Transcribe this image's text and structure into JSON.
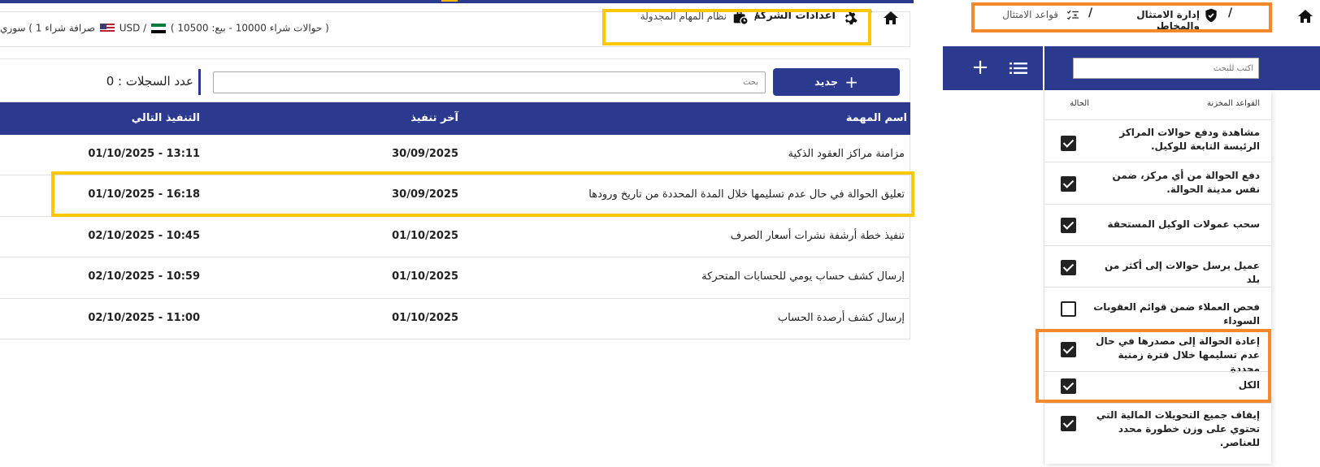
{
  "main": {
    "topbar": {
      "crumb_company": "اعدادات الشركة",
      "crumb_sep": "/",
      "crumb_scheduler": "نظام المهام المجدولة",
      "rates_text_1": "صرافة شراء 1 )",
      "rates_currency_1": "سوري",
      "rates_currency_2": "USD /",
      "rates_text_2": "( حوالات شراء 10000 - بيع: 10500 ) بة"
    },
    "toolbar": {
      "new_label": "جديد",
      "search_placeholder": "بحث",
      "count_label": "عدد السجلات : 0"
    },
    "table": {
      "headers": {
        "name": "اسم المهمة",
        "last_run": "آخر تنفيذ",
        "next_run": "التنفيذ التالي"
      },
      "rows": [
        {
          "name": "مزامنة مراكز العقود الذكية",
          "last_run": "30/09/2025",
          "next_run": "01/10/2025 - 13:11"
        },
        {
          "name": "تعليق الحوالة في حال عدم تسليمها خلال المدة المحددة من تاريخ ورودها",
          "last_run": "30/09/2025",
          "next_run": "01/10/2025 - 16:18"
        },
        {
          "name": "تنفيذ خطة أرشفة نشرات أسعار الصرف",
          "last_run": "01/10/2025",
          "next_run": "02/10/2025 - 10:45"
        },
        {
          "name": "إرسال كشف حساب يومي للحسابات المتحركة",
          "last_run": "01/10/2025",
          "next_run": "02/10/2025 - 10:59"
        },
        {
          "name": "إرسال كشف أرصدة الحساب",
          "last_run": "01/10/2025",
          "next_run": "02/10/2025 - 11:00"
        }
      ]
    }
  },
  "right": {
    "breadcrumb": {
      "sep": "/",
      "compliance": "إدارة الامتثال والمخاطر",
      "rules": "قواعد الامتثال"
    },
    "search_placeholder": "اكتب للبحث",
    "headers": {
      "rules": "القواعد المخزنة",
      "status": "الحالة"
    },
    "rules": [
      {
        "label": "مشاهدة ودفع حوالات المراكز الرئيسة التابعة للوكيل.",
        "checked": true
      },
      {
        "label": "دفع الحوالة من أي مركز، ضمن نفس مدينة الحوالة.",
        "checked": true
      },
      {
        "label": "سحب عمولات الوكيل المستحقة",
        "checked": true
      },
      {
        "label": "عميل يرسل حوالات إلى أكثر من بلد",
        "checked": true
      },
      {
        "label": "فحص العملاء ضمن قوائم العقوبات السوداء",
        "checked": false
      },
      {
        "label": "إعادة الحوالة إلى مصدرها في حال عدم تسليمها خلال فترة زمنية محددة",
        "checked": true
      },
      {
        "label": "الكل",
        "checked": true
      },
      {
        "label": "إيقاف جميع التحويلات المالية التي تحتوي على وزن خطورة محدد للعناصر.",
        "checked": true
      }
    ]
  },
  "colors": {
    "primary": "#2b3a8f",
    "highlight_yellow": "#ffc800",
    "highlight_orange": "#f5882b"
  }
}
